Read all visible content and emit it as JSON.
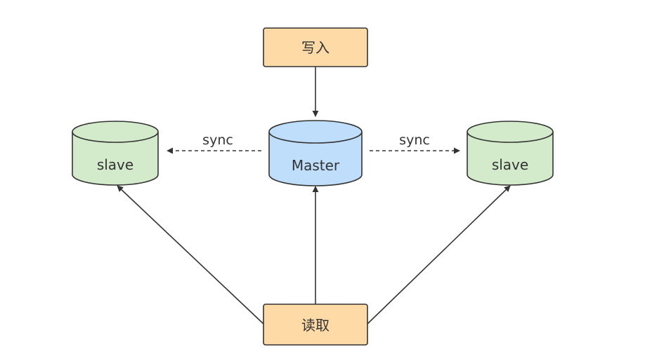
{
  "nodes": {
    "write": {
      "label": "写入",
      "shape": "rounded-rectangle",
      "fill": "#FDDAA6",
      "stroke": "#333333"
    },
    "master": {
      "label": "Master",
      "shape": "cylinder",
      "fill": "#BEDEFB",
      "stroke": "#333333"
    },
    "slave_left": {
      "label": "slave",
      "shape": "cylinder",
      "fill": "#D3EACB",
      "stroke": "#333333"
    },
    "slave_right": {
      "label": "slave",
      "shape": "cylinder",
      "fill": "#D3EACB",
      "stroke": "#333333"
    },
    "read": {
      "label": "读取",
      "shape": "rounded-rectangle",
      "fill": "#FDDAA6",
      "stroke": "#333333"
    }
  },
  "edges": {
    "write_to_master": {
      "from": "write",
      "to": "master",
      "style": "solid"
    },
    "sync_left": {
      "from": "master",
      "to": "slave_left",
      "label": "sync",
      "style": "dashed"
    },
    "sync_right": {
      "from": "master",
      "to": "slave_right",
      "label": "sync",
      "style": "dashed"
    },
    "read_to_master": {
      "from": "read",
      "to": "master",
      "style": "solid"
    },
    "read_to_slave_left": {
      "from": "read",
      "to": "slave_left",
      "style": "solid"
    },
    "read_to_slave_right": {
      "from": "read",
      "to": "slave_right",
      "style": "solid"
    }
  },
  "colors": {
    "line": "#333333",
    "box_fill": "#FDDAA6",
    "master_fill": "#BEDEFB",
    "slave_fill": "#D3EACB"
  }
}
